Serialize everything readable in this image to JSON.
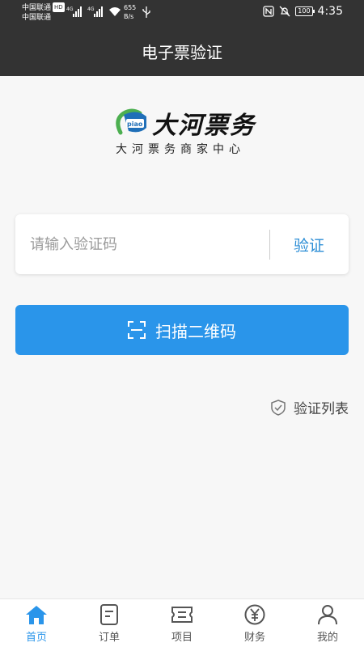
{
  "status_bar": {
    "carrier1": "中国联通",
    "carrier1_badge": "HD",
    "carrier2": "中国联通",
    "net1": "4G",
    "net2": "4G",
    "speed_value": "655",
    "speed_unit": "B/s",
    "battery": "100",
    "time": "4:35"
  },
  "header": {
    "title": "电子票验证"
  },
  "logo": {
    "mark_text": "piao",
    "title": "大河票务",
    "subtitle": "大河票务商家中心"
  },
  "verify": {
    "placeholder": "请输入验证码",
    "value": "",
    "button_label": "验证"
  },
  "scan": {
    "label": "扫描二维码"
  },
  "verify_list": {
    "label": "验证列表"
  },
  "tabbar": {
    "active": "home",
    "items": [
      {
        "id": "home",
        "label": "首页",
        "icon": "home-icon"
      },
      {
        "id": "orders",
        "label": "订单",
        "icon": "order-icon"
      },
      {
        "id": "projects",
        "label": "项目",
        "icon": "ticket-icon"
      },
      {
        "id": "finance",
        "label": "财务",
        "icon": "yen-icon"
      },
      {
        "id": "mine",
        "label": "我的",
        "icon": "user-icon"
      }
    ]
  },
  "colors": {
    "accent": "#2a95ea",
    "header_bg": "#333333",
    "verify_text": "#2c8ed6",
    "logo_green": "#4caf50"
  }
}
